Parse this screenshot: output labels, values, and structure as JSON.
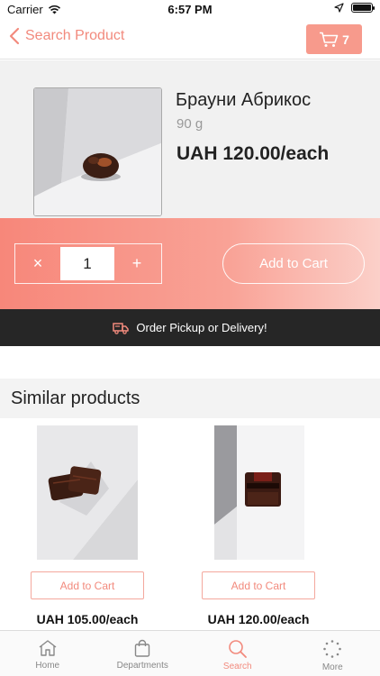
{
  "status_bar": {
    "carrier": "Carrier",
    "time": "6:57 PM"
  },
  "nav": {
    "back_label": "Search Product",
    "cart_count": "7"
  },
  "product": {
    "title": "Брауни Абрикос",
    "weight": "90 g",
    "price": "UAH 120.00/each"
  },
  "purchase": {
    "quantity": "1",
    "minus": "×",
    "plus": "+",
    "add_to_cart": "Add to Cart"
  },
  "delivery": {
    "label": "Order Pickup or Delivery!"
  },
  "similar": {
    "heading": "Similar products",
    "items": [
      {
        "button": "Add to Cart",
        "price": "UAH 105.00/each"
      },
      {
        "button": "Add to Cart",
        "price": "UAH 120.00/each"
      }
    ]
  },
  "tabs": [
    {
      "label": "Home",
      "icon": "home-icon"
    },
    {
      "label": "Departments",
      "icon": "bag-icon"
    },
    {
      "label": "Search",
      "icon": "search-icon"
    },
    {
      "label": "More",
      "icon": "more-icon"
    }
  ],
  "colors": {
    "accent": "#f28a7d",
    "dark_bar": "#262626"
  }
}
